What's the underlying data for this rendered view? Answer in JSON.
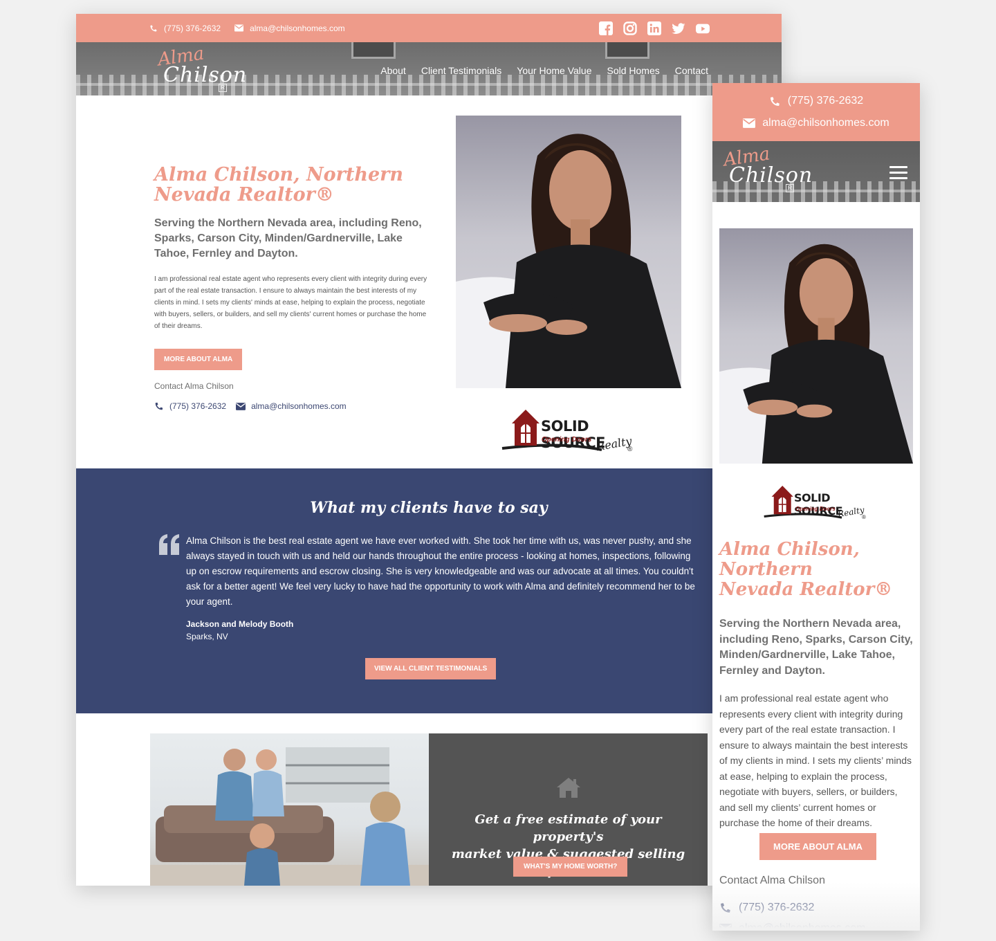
{
  "colors": {
    "accent": "#ee9b8a",
    "navy": "#3a4772",
    "dark_gray": "#545454",
    "text_gray": "#6e6e6e"
  },
  "topbar": {
    "phone": "(775) 376-2632",
    "email": "alma@chilsonhomes.com",
    "social": [
      "facebook-icon",
      "instagram-icon",
      "linkedin-icon",
      "twitter-icon",
      "youtube-icon"
    ]
  },
  "logo": {
    "line1": "Alma",
    "line2": "Chilson",
    "badge": "R"
  },
  "nav": {
    "items": [
      "About",
      "Client Testimonials",
      "Your Home Value",
      "Sold Homes",
      "Contact"
    ]
  },
  "hero": {
    "title": "Alma Chilson, Northern Nevada Realtor®",
    "title_line1": "Alma Chilson, Northern",
    "title_line2": "Nevada Realtor®",
    "subtitle": "Serving the Northern Nevada area, including Reno, Sparks, Carson City, Minden/Gardnerville, Lake Tahoe, Fernley and Dayton.",
    "body": "I am professional real estate agent who represents every client with integrity during every part of the real estate transaction. I ensure to always maintain the best interests of my clients in mind. I sets my clients' minds at ease, helping to explain the process, negotiate with buyers, sellers, or builders, and sell my clients' current homes or purchase the home of their dreams.",
    "mobile_body": "I am professional real estate agent who represents every client with integrity during every part of the real estate transaction. I ensure to always maintain the best interests of my clients in mind. I sets my clients’ minds at ease, helping to explain the process, negotiate with buyers, sellers, or builders, and sell my clients’ current homes or purchase the home of their dreams.",
    "button": "MORE ABOUT ALMA",
    "contact_label": "Contact Alma Chilson",
    "phone": "(775) 376-2632",
    "email": "alma@chilsonhomes.com"
  },
  "brokerage": {
    "name": "SOLID SOURCE",
    "tagline": "Opening Doors",
    "script": "Realty",
    "mark": "®"
  },
  "testimonials": {
    "title": "What my clients have to say",
    "quote": "Alma Chilson is the best real estate agent we have ever worked with. She took her time with us, was never pushy, and she always stayed in touch with us and held our hands throughout the entire process - looking at homes, inspections, following up on escrow requirements and escrow closing. She is very knowledgeable and was our advocate at all times. You couldn't ask for a better agent! We feel very lucky to have had the opportunity to work with Alma and definitely recommend her to be your agent.",
    "author": "Jackson and Melody Booth",
    "location": "Sparks, NV",
    "button": "VIEW ALL CLIENT TESTIMONIALS"
  },
  "estimate": {
    "line1": "Get a free estimate of your property's",
    "line2": "market value & suggested selling price!",
    "button": "WHAT'S MY HOME WORTH?"
  }
}
